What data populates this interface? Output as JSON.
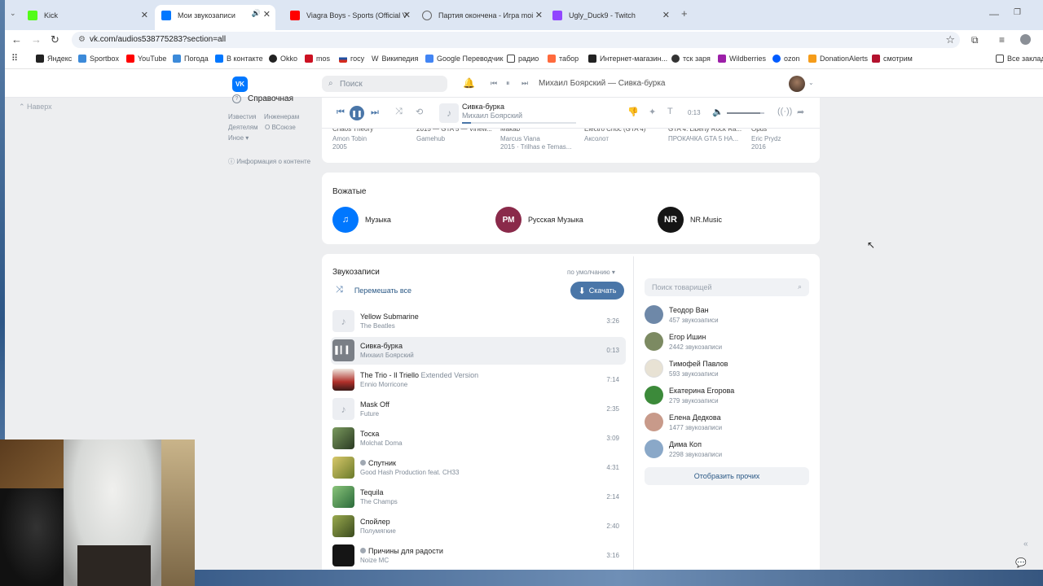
{
  "browser": {
    "tabs": [
      {
        "label": "Kick",
        "color": "#53fc18"
      },
      {
        "label": "Мои звукозаписи",
        "color": "#0077ff"
      },
      {
        "label": "Viagra Boys - Sports (Official Vi",
        "color": "#ff0000"
      },
      {
        "label": "Партия окончена - Игра moi",
        "color": "#888888"
      },
      {
        "label": "Ugly_Duck9 - Twitch",
        "color": "#9146ff"
      }
    ],
    "new_tab": "+",
    "url": "vk.com/audios538775283?section=all",
    "bookmarks": [
      {
        "label": "Яндекс",
        "color": "#222222"
      },
      {
        "label": "Sportbox",
        "color": "#3c8ad9"
      },
      {
        "label": "YouTube",
        "color": "#ff0000"
      },
      {
        "label": "Погода",
        "color": "#3c8ad9"
      },
      {
        "label": "В контакте",
        "color": "#0077ff"
      },
      {
        "label": "Okko",
        "color": "#222222"
      },
      {
        "label": "mos",
        "color": "#cc1122"
      },
      {
        "label": "госу",
        "color": "#1f4fa0"
      },
      {
        "label": "Википедия",
        "color": "#ffffff"
      },
      {
        "label": "Google Переводчик",
        "color": "#4285f4"
      },
      {
        "label": "радио",
        "color": "#ffffff"
      },
      {
        "label": "табор",
        "color": "#ff6a3d"
      },
      {
        "label": "Интернет-магазин...",
        "color": "#222222"
      },
      {
        "label": "тск заря",
        "color": "#333333"
      },
      {
        "label": "Wildberries",
        "color": "#9c1fa8"
      },
      {
        "label": "ozon",
        "color": "#005bff"
      },
      {
        "label": "DonationAlerts",
        "color": "#f59c1a"
      },
      {
        "label": "смотрим",
        "color": "#b3122e"
      }
    ],
    "all_bookmarks": "Все заклад"
  },
  "vk": {
    "logo": "VK",
    "search_placeholder": "Поиск",
    "now_playing_header": "Михаил Боярский — Сивка-бурка",
    "back_to_top": "Наверх",
    "sidebar": {
      "help": "Справочная",
      "links": [
        "Известия",
        "Инженерам",
        "Деятелям",
        "О ВСоюзе",
        "Иное ▾"
      ],
      "info": "Информация о контенте"
    },
    "player": {
      "title": "Сивка-бурка",
      "artist": "Михаил Боярский",
      "time": "0:13",
      "progress": 0.08,
      "volume": 0.9
    },
    "albums": [
      {
        "top": "Chaos Theory",
        "artist": "Amon Tobin",
        "meta": "2005"
      },
      {
        "top": "2015 — GTA 5 — Vinew...",
        "artist": "Gamehub",
        "meta": ""
      },
      {
        "top": "Makab",
        "artist": "Marcus Viana",
        "meta": "2015 · Trilhas e Temas..."
      },
      {
        "top": "Electro Choc (GTA 4)",
        "artist": "Аксолот",
        "meta": ""
      },
      {
        "top": "GTA 4: Liberty Rock Ra...",
        "artist": "ПРОКАЧКА GTA 5 НА...",
        "meta": ""
      },
      {
        "top": "Opus",
        "artist": "Eric Prydz",
        "meta": "2016"
      }
    ],
    "curators": {
      "title": "Вожатые",
      "items": [
        {
          "name": "Музыка",
          "badge": "♫",
          "color": "#0077ff"
        },
        {
          "name": "Русская Музыка",
          "badge": "РМ",
          "color": "#8a2a4a"
        },
        {
          "name": "NR.Music",
          "badge": "NR",
          "color": "#151515"
        }
      ]
    },
    "tracks": {
      "title": "Звукозаписи",
      "sort": "по умолчанию ▾",
      "shuffle": "Перемешать все",
      "download": "Скачать",
      "items": [
        {
          "title": "Yellow Submarine",
          "extra": "",
          "artist": "The Beatles",
          "duration": "3:26",
          "cover": "#eceef2",
          "explicit": false
        },
        {
          "title": "Сивка-бурка",
          "extra": "",
          "artist": "Михаил Боярский",
          "duration": "0:13",
          "cover": "#7a7f86",
          "explicit": false
        },
        {
          "title": "The Trio - Il Triello",
          "extra": "Extended Version",
          "artist": "Ennio Morricone",
          "duration": "7:14",
          "cover": "#b0302a",
          "explicit": false
        },
        {
          "title": "Mask Off",
          "extra": "",
          "artist": "Future",
          "duration": "2:35",
          "cover": "#eceef2",
          "explicit": false
        },
        {
          "title": "Тоска",
          "extra": "",
          "artist": "Molchat Doma",
          "duration": "3:09",
          "cover": "#3f5a33",
          "explicit": false
        },
        {
          "title": "Спутник",
          "extra": "",
          "artist": "Good Hash Production feat. CH33",
          "duration": "4:31",
          "cover": "#a89a3a",
          "explicit": true
        },
        {
          "title": "Tequila",
          "extra": "",
          "artist": "The Champs",
          "duration": "2:14",
          "cover": "#5b9a55",
          "explicit": false
        },
        {
          "title": "Спойлер",
          "extra": "",
          "artist": "Полумягкие",
          "duration": "2:40",
          "cover": "#5a7a2e",
          "explicit": false
        },
        {
          "title": "Причины для радости",
          "extra": "",
          "artist": "Noize MC",
          "duration": "3:16",
          "cover": "#151515",
          "explicit": true
        }
      ]
    },
    "friends": {
      "search_placeholder": "Поиск товарищей",
      "items": [
        {
          "name": "Теодор Ван",
          "count": "457 звукозаписи",
          "color": "#6e88a8"
        },
        {
          "name": "Егор Ишин",
          "count": "2442 звукозаписи",
          "color": "#7c8a62"
        },
        {
          "name": "Тимофей Павлов",
          "count": "593 звукозаписи",
          "color": "#e8e2d4"
        },
        {
          "name": "Екатерина Егорова",
          "count": "279 звукозаписи",
          "color": "#3c8a3a"
        },
        {
          "name": "Елена Дедкова",
          "count": "1477 звукозаписи",
          "color": "#c89a8a"
        },
        {
          "name": "Дима Коп",
          "count": "2298 звукозаписи",
          "color": "#8aa8c8"
        }
      ],
      "show_more": "Отобразить прочих"
    }
  }
}
